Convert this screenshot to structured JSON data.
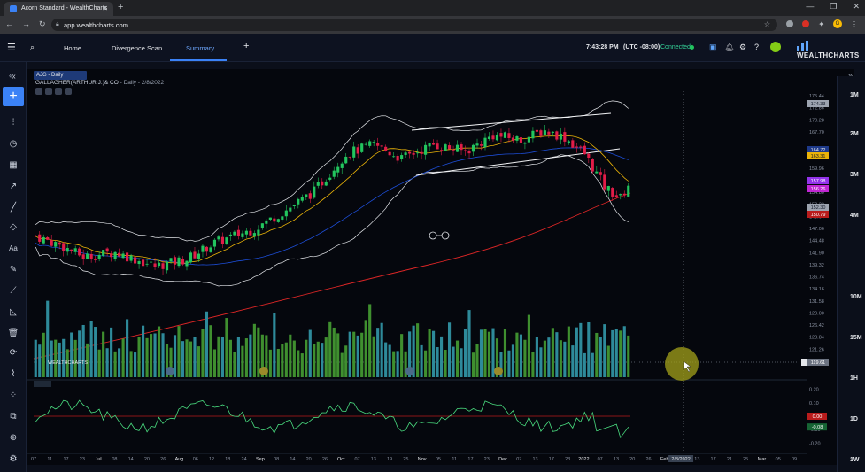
{
  "browser": {
    "tab_title": "Acorn Standard - WealthCharts",
    "url": "app.wealthcharts.com",
    "profile_initial": "G"
  },
  "nav": {
    "home": "Home",
    "divergence": "Divergence Scan",
    "summary": "Summary",
    "add": "+",
    "time": "7:43:28 PM",
    "timezone": "(UTC -08:00)",
    "connection": "Connected",
    "brand": "WEALTHCHARTS"
  },
  "chart_header": {
    "tab_label": "AJG - Daily",
    "symbol_name": "GALLAGHER(ARTHUR J.)& CO",
    "interval_date": "- Daily - 2/8/2022",
    "volume_brand": "WEALTHCHARTS"
  },
  "timeframes": [
    "1M",
    "2M",
    "3M",
    "4M",
    "10M",
    "15M",
    "1H",
    "1D",
    "1W"
  ],
  "price_axis": {
    "ticks": [
      "175.44",
      "172.86",
      "170.28",
      "167.70",
      "162.54",
      "159.96",
      "157.38",
      "154.80",
      "152.22",
      "149.64",
      "147.06",
      "144.48",
      "141.90",
      "139.32",
      "136.74",
      "134.16",
      "131.58",
      "129.00",
      "126.42",
      "123.84",
      "121.26",
      "118.68"
    ],
    "badges": [
      {
        "label": "174.33",
        "color": "#9ca3af",
        "text": "#111827"
      },
      {
        "label": "164.72",
        "color": "#1e3a8a",
        "text": "#e5e7eb"
      },
      {
        "label": "163.31",
        "color": "#eab308",
        "text": "#111827"
      },
      {
        "label": "157.98",
        "color": "#9333ea",
        "text": "#ffffff"
      },
      {
        "label": "156.26",
        "color": "#c026d3",
        "text": "#ffffff"
      },
      {
        "label": "152.30",
        "color": "#9ca3af",
        "text": "#111827"
      },
      {
        "label": "150.79",
        "color": "#b91c1c",
        "text": "#ffffff"
      },
      {
        "label": "119.61",
        "color": "#6b7280",
        "text": "#ffffff"
      }
    ]
  },
  "oscillator_axis": {
    "ticks": [
      "0.20",
      "0.10",
      "0.00",
      "-0.10",
      "-0.20"
    ],
    "badges": [
      {
        "label": "0.00",
        "color": "#b91c1c"
      },
      {
        "label": "-0.08",
        "color": "#166534"
      }
    ]
  },
  "time_axis": [
    "07",
    "11",
    "17",
    "23",
    "Jul",
    "08",
    "14",
    "20",
    "26",
    "Aug",
    "06",
    "12",
    "18",
    "24",
    "Sep",
    "08",
    "14",
    "20",
    "26",
    "Oct",
    "07",
    "13",
    "19",
    "25",
    "Nov",
    "05",
    "11",
    "17",
    "23",
    "Dec",
    "07",
    "13",
    "17",
    "23",
    "2022",
    "07",
    "13",
    "20",
    "26",
    "Feb",
    "2/8/2022",
    "13",
    "17",
    "21",
    "25",
    "Mar",
    "05",
    "09"
  ],
  "colors": {
    "bull": "#22c55e",
    "bear": "#e11d48",
    "ma200": "#dc2626",
    "ma50": "#1d4ed8",
    "ma20": "#eab308",
    "bollinger": "#e5e7eb",
    "accent": "#3b82f6"
  }
}
